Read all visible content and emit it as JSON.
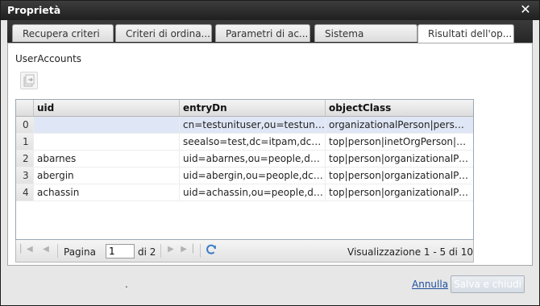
{
  "window": {
    "title": "Proprietà",
    "close_glyph": "✕"
  },
  "tabs": [
    {
      "label": "Recupera criteri"
    },
    {
      "label": "Criteri di ordina..."
    },
    {
      "label": "Parametri di ac..."
    },
    {
      "label": "Sistema"
    },
    {
      "label": "Risultati dell'op..."
    }
  ],
  "panel": {
    "label": "UserAccounts",
    "toolbar_icon": "export-icon"
  },
  "grid": {
    "columns": [
      "uid",
      "entryDn",
      "objectClass"
    ],
    "rows": [
      {
        "index": "0",
        "uid": "",
        "entryDn": "cn=testunituser,ou=testunit3...",
        "objectClass": "organizationalPerson|person..."
      },
      {
        "index": "1",
        "uid": "",
        "entryDn": "seealso=test,dc=itpam,dc=c...",
        "objectClass": "top|person|inetOrgPerson|or..."
      },
      {
        "index": "2",
        "uid": "abarnes",
        "entryDn": "uid=abarnes,ou=people,dc=...",
        "objectClass": "top|person|organizationalPe..."
      },
      {
        "index": "3",
        "uid": "abergin",
        "entryDn": "uid=abergin,ou=people,dc=i...",
        "objectClass": "top|person|organizationalPe..."
      },
      {
        "index": "4",
        "uid": "achassin",
        "entryDn": "uid=achassin,ou=people,dc...",
        "objectClass": "top|person|organizationalPe..."
      }
    ],
    "selected_row": 0
  },
  "pager": {
    "page_label": "Pagina",
    "page_value": "1",
    "of_label": "di 2",
    "summary": "Visualizzazione 1 - 5 di 10"
  },
  "footer": {
    "dot": ".",
    "cancel_label": "Annulla",
    "save_label": "Salva e chiudi"
  },
  "colors": {
    "title_bar": "#2a2a2a",
    "tab_strip": "#303030",
    "selected_row": "#dfe6f5",
    "link": "#1f4f9f",
    "refresh_icon": "#3a7cc4"
  }
}
